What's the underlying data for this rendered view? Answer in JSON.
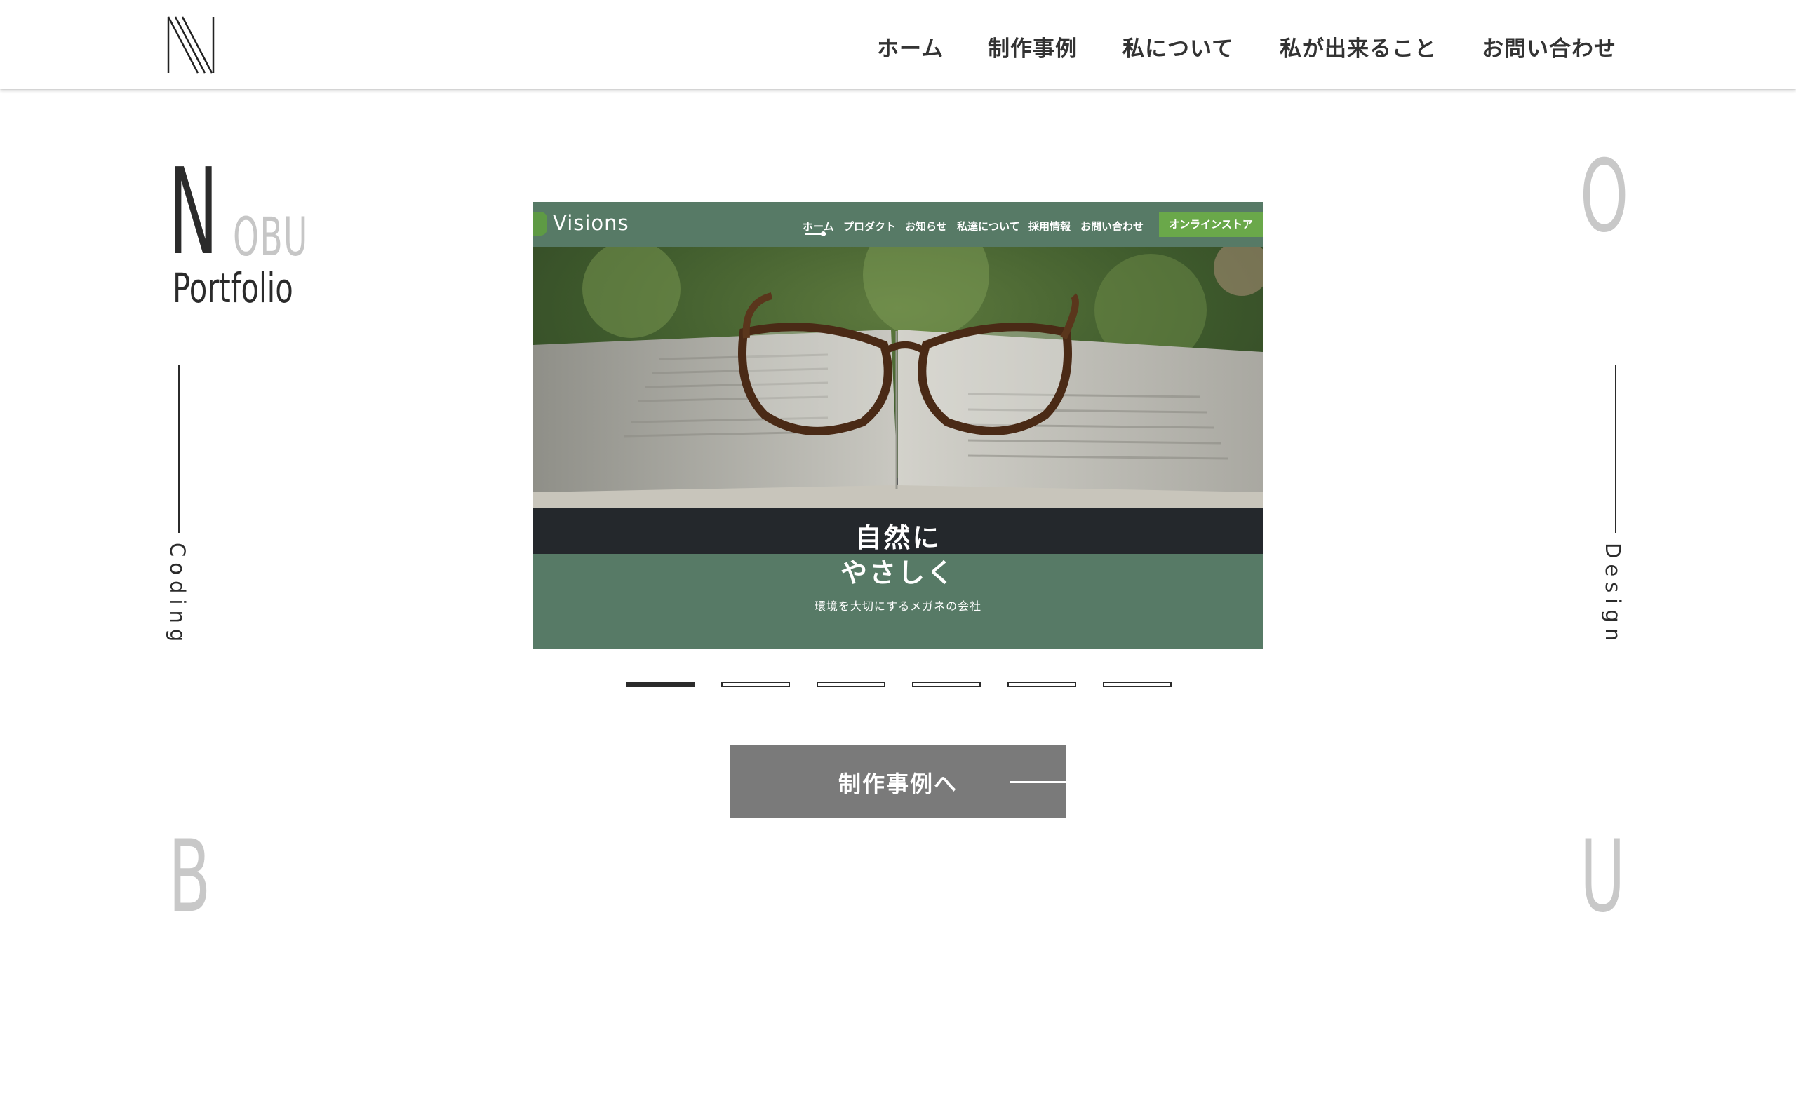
{
  "header": {
    "logo": "N-logo",
    "nav": [
      "ホーム",
      "制作事例",
      "私について",
      "私が出来ること",
      "お問い合わせ"
    ]
  },
  "hero": {
    "big_letter": "N",
    "big_letter_suffix": "OBU",
    "subtitle": "Portfolio",
    "corner_letters": {
      "top_right": "O",
      "bottom_left": "B",
      "bottom_right": "U"
    },
    "left_label": "Coding",
    "right_label": "Design"
  },
  "slide": {
    "site_logo": "Visions",
    "site_nav": [
      "ホーム",
      "プロダクト",
      "お知らせ",
      "私達について",
      "採用情報",
      "お問い合わせ"
    ],
    "store_button": "オンラインストア",
    "headline_line1": "自然に",
    "headline_line2": "やさしく",
    "tagline": "環境を大切にするメガネの会社"
  },
  "pager": {
    "count": 6,
    "active_index": 1
  },
  "cta": {
    "label": "制作事例へ"
  }
}
